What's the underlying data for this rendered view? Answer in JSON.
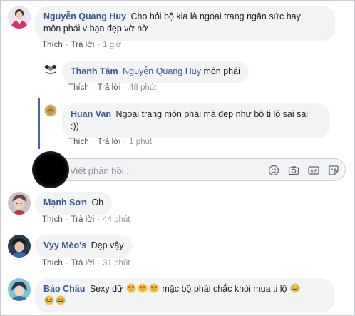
{
  "comments": [
    {
      "author": "Nguyễn Quang Huy",
      "text": "Cho hỏi bộ kia là ngoại trang ngân sức hay môn phái v bạn đẹp vờ nờ",
      "line1": "Cho hỏi bộ kia là ngoại trang ngân sức hay",
      "line2": "môn phái v bạn đẹp vờ nờ",
      "like": "Thích",
      "reply": "Trả lời",
      "time": "1 giờ"
    },
    {
      "author": "Thanh Tâm",
      "mention": "Nguyễn Quang Huy",
      "text": "môn phái",
      "like": "Thích",
      "reply": "Trả lời",
      "time": "48 phút"
    },
    {
      "author": "Huan Van",
      "text": "Ngoại trang môn phái mà đẹp như bộ ti lộ sai sai :))",
      "line1": "Ngoại trang môn phái mà đẹp như bộ ti lộ sai sai",
      "line2": ":))",
      "like": "Thích",
      "reply": "Trả lời",
      "time": "1 phút"
    },
    {
      "author": "Mạnh Sơn",
      "text": "Oh",
      "like": "Thích",
      "reply": "Trả lời",
      "time": "44 phút"
    },
    {
      "author": "Vyy Mèo's",
      "text": "Đẹp vậy",
      "like": "Thích",
      "reply": "Trả lời",
      "time": "31 phút"
    },
    {
      "author": "Bảo Châu",
      "text_before": "Sexy dữ",
      "text_after": "mặc bộ phái chắc khỏi mua ti lộ"
    }
  ],
  "reply_box": {
    "placeholder": "Viết phản hồi...",
    "icons": [
      "emoji-icon",
      "camera-icon",
      "gif-icon",
      "sticker-icon"
    ],
    "gif_label": "GIF"
  },
  "colors": {
    "link": "#385898",
    "bubble": "#f2f3f5",
    "meta": "#90949c",
    "thread": "#4267b2"
  }
}
